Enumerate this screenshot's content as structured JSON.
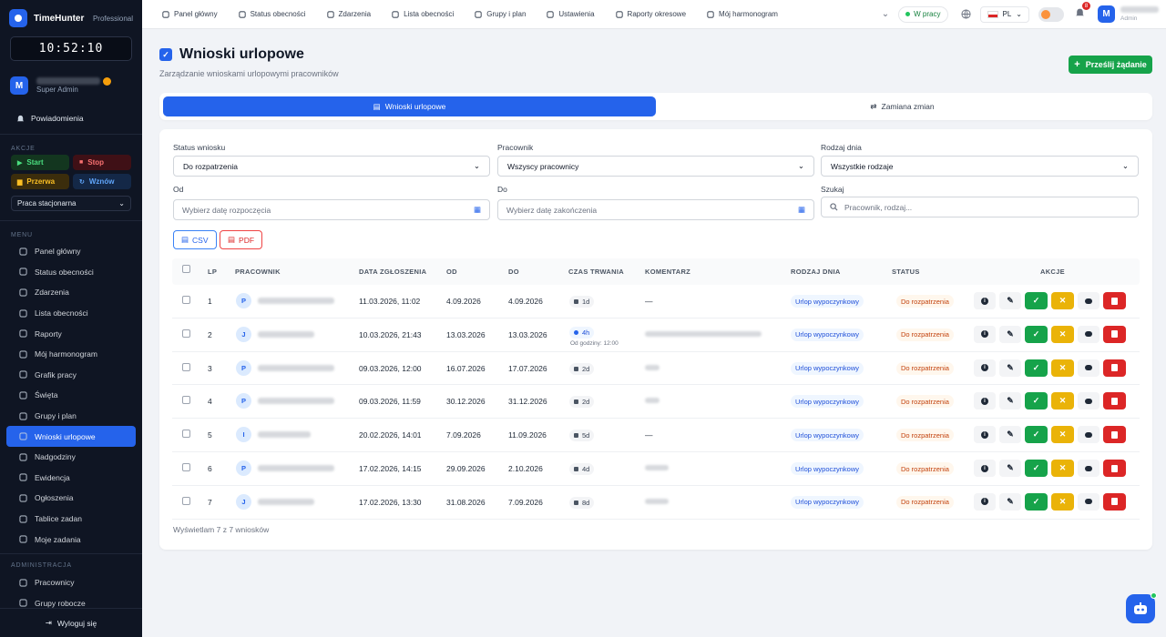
{
  "sidebar": {
    "brand": "TimeHunter",
    "plan": "Professional",
    "clock": "10:52:10",
    "user_initial": "M",
    "user_role": "Super Admin",
    "notifications": "Powiadomienia",
    "actions_header": "AKCJE",
    "start": "Start",
    "stop": "Stop",
    "break": "Przerwa",
    "resume": "Wznów",
    "work_mode": "Praca stacjonarna",
    "menu_header": "MENU",
    "menu": [
      "Panel główny",
      "Status obecności",
      "Zdarzenia",
      "Lista obecności",
      "Raporty",
      "Mój harmonogram",
      "Grafik pracy",
      "Święta",
      "Grupy i plan",
      "Wnioski urlopowe",
      "Nadgodziny",
      "Ewidencja",
      "Ogłoszenia",
      "Tablice zadan",
      "Moje zadania"
    ],
    "admin_header": "ADMINISTRACJA",
    "admin_menu": [
      "Pracownicy",
      "Grupy robocze"
    ],
    "logout": "Wyloguj się"
  },
  "topnav": {
    "items": [
      "Panel główny",
      "Status obecności",
      "Zdarzenia",
      "Lista obecności",
      "Grupy i plan",
      "Ustawienia",
      "Raporty okresowe",
      "Mój harmonogram"
    ],
    "status": "W pracy",
    "lang": "PL",
    "notif_count": "8",
    "user_initial": "M",
    "user_role": "Admin"
  },
  "page": {
    "title": "Wnioski urlopowe",
    "subtitle": "Zarządzanie wnioskami urlopowymi pracowników",
    "send_button": "Prześlij żądanie",
    "tabs": [
      "Wnioski urlopowe",
      "Zamiana zmian"
    ]
  },
  "filters": {
    "status_label": "Status wniosku",
    "status_value": "Do rozpatrzenia",
    "employee_label": "Pracownik",
    "employee_value": "Wszyscy pracownicy",
    "daytype_label": "Rodzaj dnia",
    "daytype_value": "Wszystkie rodzaje",
    "from_label": "Od",
    "from_placeholder": "Wybierz datę rozpoczęcia",
    "to_label": "Do",
    "to_placeholder": "Wybierz datę zakończenia",
    "search_label": "Szukaj",
    "search_placeholder": "Pracownik, rodzaj..."
  },
  "export": {
    "csv": "CSV",
    "pdf": "PDF"
  },
  "table": {
    "headers": [
      "LP",
      "PRACOWNIK",
      "DATA ZGŁOSZENIA",
      "OD",
      "DO",
      "CZAS TRWANIA",
      "KOMENTARZ",
      "RODZAJ DNIA",
      "STATUS",
      "AKCJE"
    ],
    "rows": [
      {
        "lp": "1",
        "initial": "P",
        "submitted": "11.03.2026, 11:02",
        "from": "4.09.2026",
        "to": "4.09.2026",
        "duration": "1d",
        "duration_note": "",
        "comment": "—",
        "day_type": "Urlop wypoczynkowy",
        "status": "Do rozpatrzenia"
      },
      {
        "lp": "2",
        "initial": "J",
        "submitted": "10.03.2026, 21:43",
        "from": "13.03.2026",
        "to": "13.03.2026",
        "duration": "4h",
        "duration_note": "Od godziny: 12:00",
        "comment": "",
        "day_type": "Urlop wypoczynkowy",
        "status": "Do rozpatrzenia"
      },
      {
        "lp": "3",
        "initial": "P",
        "submitted": "09.03.2026, 12:00",
        "from": "16.07.2026",
        "to": "17.07.2026",
        "duration": "2d",
        "duration_note": "",
        "comment": "",
        "day_type": "Urlop wypoczynkowy",
        "status": "Do rozpatrzenia"
      },
      {
        "lp": "4",
        "initial": "P",
        "submitted": "09.03.2026, 11:59",
        "from": "30.12.2026",
        "to": "31.12.2026",
        "duration": "2d",
        "duration_note": "",
        "comment": "",
        "day_type": "Urlop wypoczynkowy",
        "status": "Do rozpatrzenia"
      },
      {
        "lp": "5",
        "initial": "I",
        "submitted": "20.02.2026, 14:01",
        "from": "7.09.2026",
        "to": "11.09.2026",
        "duration": "5d",
        "duration_note": "",
        "comment": "—",
        "day_type": "Urlop wypoczynkowy",
        "status": "Do rozpatrzenia"
      },
      {
        "lp": "6",
        "initial": "P",
        "submitted": "17.02.2026, 14:15",
        "from": "29.09.2026",
        "to": "2.10.2026",
        "duration": "4d",
        "duration_note": "",
        "comment": "",
        "day_type": "Urlop wypoczynkowy",
        "status": "Do rozpatrzenia"
      },
      {
        "lp": "7",
        "initial": "J",
        "submitted": "17.02.2026, 13:30",
        "from": "31.08.2026",
        "to": "7.09.2026",
        "duration": "8d",
        "duration_note": "",
        "comment": "",
        "day_type": "Urlop wypoczynkowy",
        "status": "Do rozpatrzenia"
      }
    ],
    "footer": "Wyświetlam 7 z 7 wniosków"
  }
}
